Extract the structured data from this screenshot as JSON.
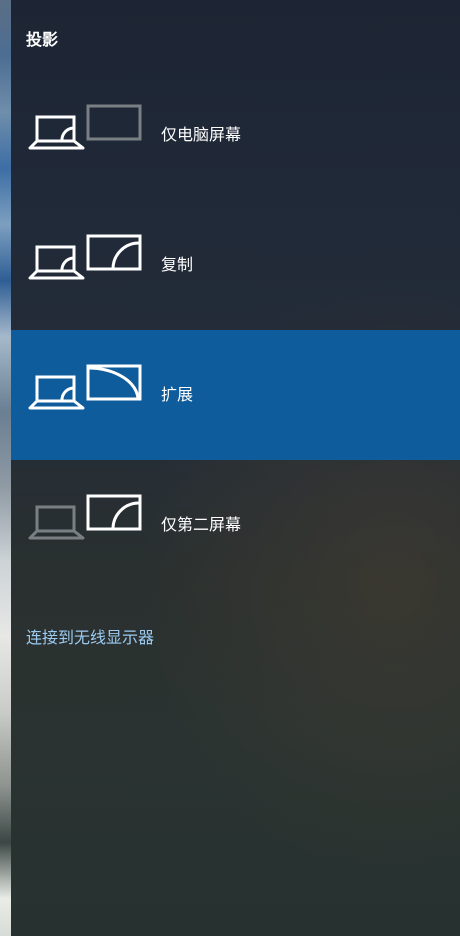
{
  "panel": {
    "title": "投影",
    "options": [
      {
        "label": "仅电脑屏幕",
        "icon": "pc-screen-only-icon",
        "selected": false
      },
      {
        "label": "复制",
        "icon": "duplicate-icon",
        "selected": false
      },
      {
        "label": "扩展",
        "icon": "extend-icon",
        "selected": true
      },
      {
        "label": "仅第二屏幕",
        "icon": "second-screen-only-icon",
        "selected": false
      }
    ],
    "wireless_link": "连接到无线显示器"
  },
  "colors": {
    "selected_background": "#0f5c9c",
    "link": "#9ccbf1",
    "dimmed_icon": "#7a7f84",
    "text": "#ffffff"
  }
}
